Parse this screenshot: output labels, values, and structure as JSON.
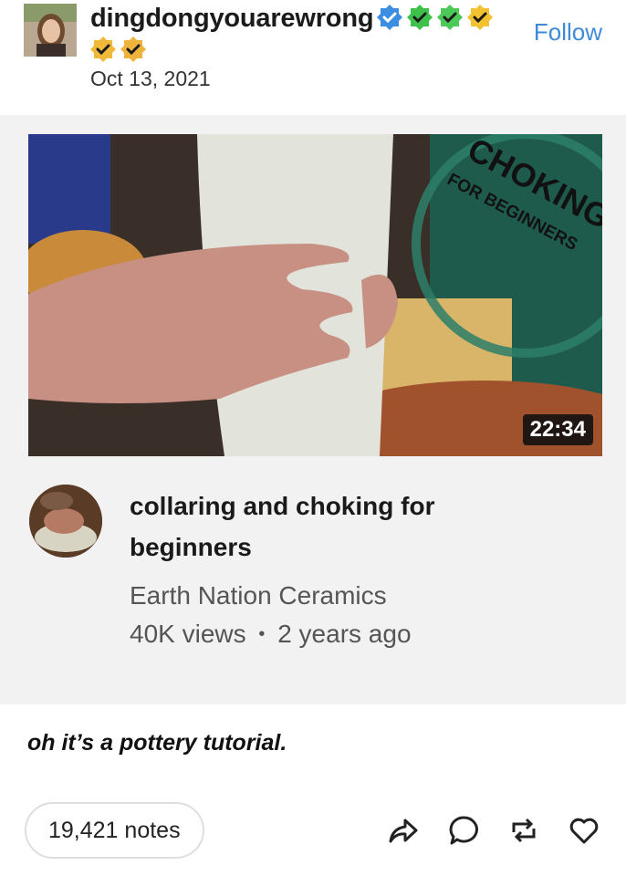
{
  "post": {
    "username": "dingdongyouarewrong",
    "date": "Oct 13, 2021",
    "follow_label": "Follow",
    "badges": [
      "blue-check-badge",
      "green-check-badge",
      "green-check-badge",
      "yellow-check-badge",
      "yellow-check-badge",
      "yellow-check-badge"
    ]
  },
  "embed": {
    "thumbnail_title_line1": "CHOKING",
    "thumbnail_title_line2": "FOR BEGINNERS",
    "duration": "22:34",
    "title": "collaring and choking for beginners",
    "channel": "Earth Nation Ceramics",
    "views": "40K views",
    "separator": "•",
    "age": "2 years ago"
  },
  "caption": "oh it’s a pottery tutorial.",
  "footer": {
    "notes": "19,421 notes",
    "actions": [
      "share-icon",
      "reply-icon",
      "reblog-icon",
      "like-icon"
    ]
  },
  "colors": {
    "follow": "#3d8bd6",
    "card_bg": "#f2f2f2",
    "thumb_accent": "#1f6b5a"
  }
}
